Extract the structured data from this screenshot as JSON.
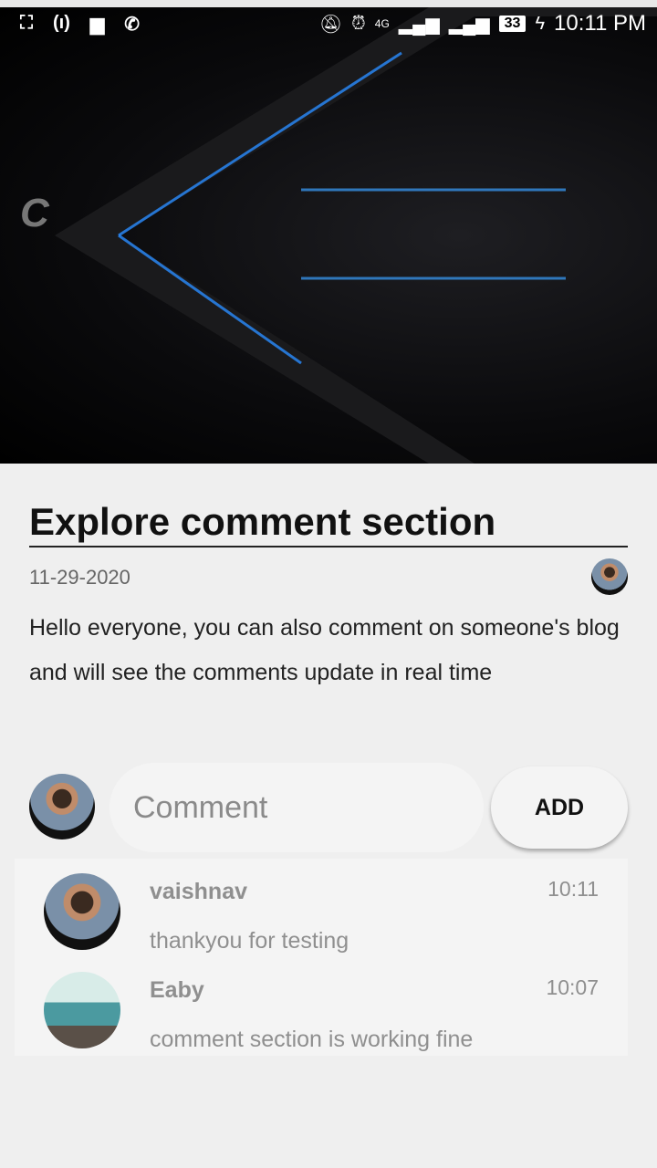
{
  "status_bar": {
    "time": "10:11 PM",
    "battery": "33",
    "network": "4G"
  },
  "post": {
    "title": "Explore comment section",
    "date": "11-29-2020",
    "body": "Hello everyone, you can also comment on someone's blog and will see the comments update in real time"
  },
  "comment_input": {
    "placeholder": "Comment",
    "value": ""
  },
  "add_button": {
    "label": "ADD"
  },
  "comments": [
    {
      "user": "vaishnav",
      "text": "thankyou for testing",
      "time": "10:11"
    },
    {
      "user": "Eaby",
      "text": "comment section is working fine",
      "time": "10:07"
    }
  ]
}
